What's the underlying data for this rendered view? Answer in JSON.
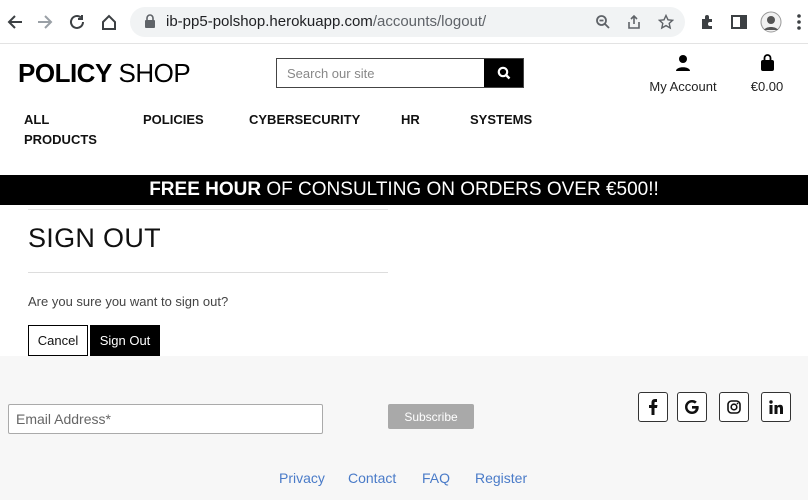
{
  "browser": {
    "url_host": "ib-pp5-polshop.herokuapp.com",
    "url_path": "/accounts/logout/"
  },
  "header": {
    "logo_bold": "POLICY",
    "logo_light": " SHOP",
    "search_placeholder": "Search our site",
    "account_label": "My Account",
    "bag_total": "€0.00"
  },
  "nav": {
    "items": [
      {
        "label": "ALL"
      },
      {
        "label": "PRODUCTS"
      },
      {
        "label": "POLICIES"
      },
      {
        "label": "CYBERSECURITY"
      },
      {
        "label": "HR"
      },
      {
        "label": "SYSTEMS"
      }
    ]
  },
  "banner": {
    "bold": "FREE HOUR",
    "rest": " OF CONSULTING ON ORDERS OVER €500!!"
  },
  "content": {
    "title": "SIGN OUT",
    "question": "Are you sure you want to sign out?",
    "cancel_label": "Cancel",
    "signout_label": "Sign Out"
  },
  "footer": {
    "email_placeholder": "Email Address*",
    "subscribe_label": "Subscribe",
    "social_icons": [
      "facebook-icon",
      "google-icon",
      "instagram-icon",
      "linkedin-icon"
    ],
    "links": [
      "Privacy",
      "Contact",
      "FAQ",
      "Register"
    ]
  },
  "colors": {
    "banner_bg": "#000000",
    "link": "#4a7bc8",
    "subscribe_bg": "#a9a9a9"
  }
}
